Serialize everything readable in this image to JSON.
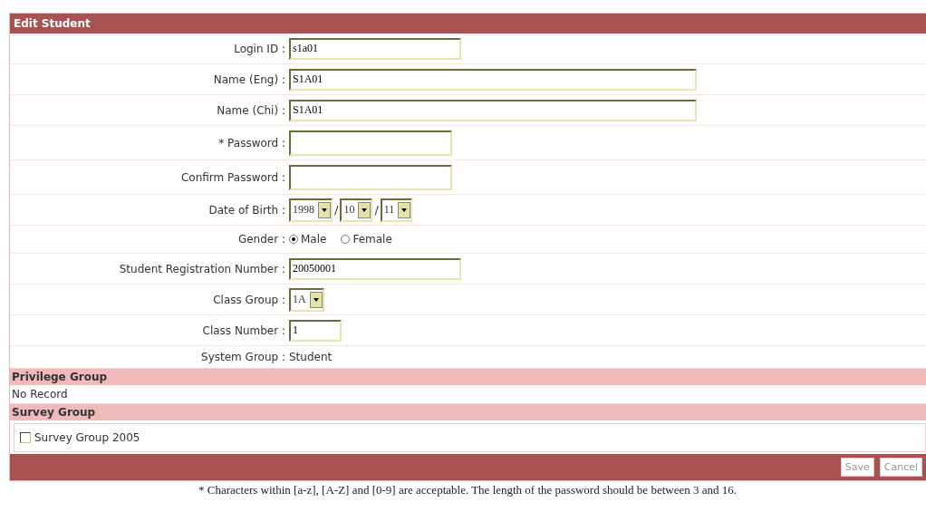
{
  "title": "Edit Student",
  "fields": [
    {
      "kind": "text",
      "label": "Login ID :",
      "value": "s1a01"
    },
    {
      "kind": "text",
      "label": "Name (Eng) :",
      "value": "S1A01"
    },
    {
      "kind": "text",
      "label": "Name (Chi) :",
      "value": "S1A01"
    },
    {
      "kind": "password",
      "label": "* Password :"
    },
    {
      "kind": "password",
      "label": "Confirm Password :"
    },
    {
      "kind": "date",
      "label": "Date of Birth :",
      "parts": [
        "1998",
        "10",
        "11"
      ],
      "separator": "/"
    },
    {
      "kind": "radio",
      "label": "Gender :",
      "options": [
        {
          "label": "Male",
          "selected": true
        },
        {
          "label": "Female",
          "selected": false
        }
      ]
    },
    {
      "kind": "text",
      "label": "Student Registration Number :",
      "value": "20050001"
    },
    {
      "kind": "select",
      "label": "Class Group :",
      "value": "1A"
    },
    {
      "kind": "text",
      "label": "Class Number :",
      "value": "1"
    },
    {
      "kind": "static",
      "label": "System Group :",
      "value": "Student"
    }
  ],
  "privilege_group": {
    "title": "Privilege Group",
    "text": "No Record"
  },
  "survey_group": {
    "title": "Survey Group",
    "items": [
      {
        "label": "Survey Group 2005",
        "checked": false
      }
    ]
  },
  "buttons": [
    "Save",
    "Cancel"
  ],
  "note": "* Characters within [a-z], [A-Z] and [0-9] are acceptable. The length of the password should be between 3 and 16."
}
